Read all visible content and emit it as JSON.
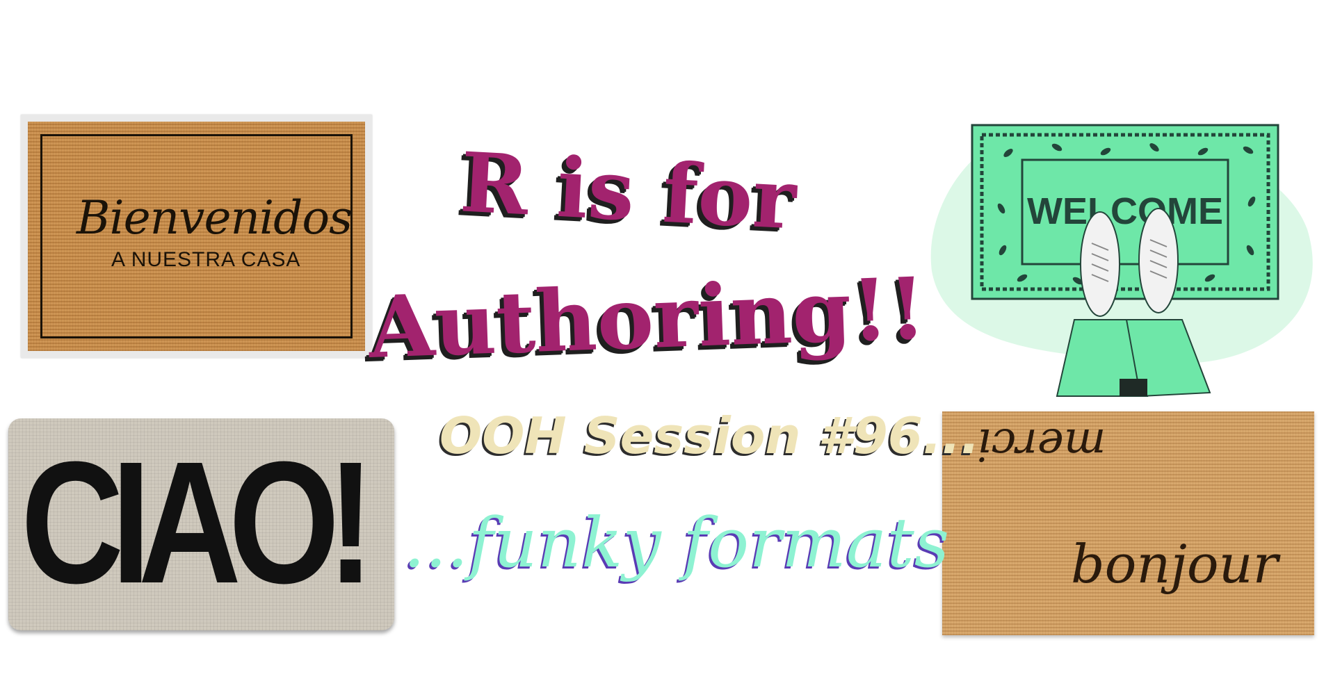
{
  "headline": {
    "line1": "R is for",
    "line2": "Authoring!!"
  },
  "subtitles": {
    "session": "OOH Session #96...",
    "formats": "...funky formats"
  },
  "mats": {
    "bienvenidos": {
      "script": "Bienvenidos",
      "subtitle": "A NUESTRA CASA"
    },
    "welcome": {
      "label": "WELCOME"
    },
    "ciao": {
      "label": "CIAO!"
    },
    "french": {
      "top": "merci",
      "bottom": "bonjour"
    }
  },
  "colors": {
    "headline": "#a2236e",
    "session": "#efe4b8",
    "formats": "#8ef2d2",
    "welcome_mat": "#6ee7a8"
  },
  "icons": [
    "sneakers-illustration",
    "leaf-vine-border"
  ]
}
